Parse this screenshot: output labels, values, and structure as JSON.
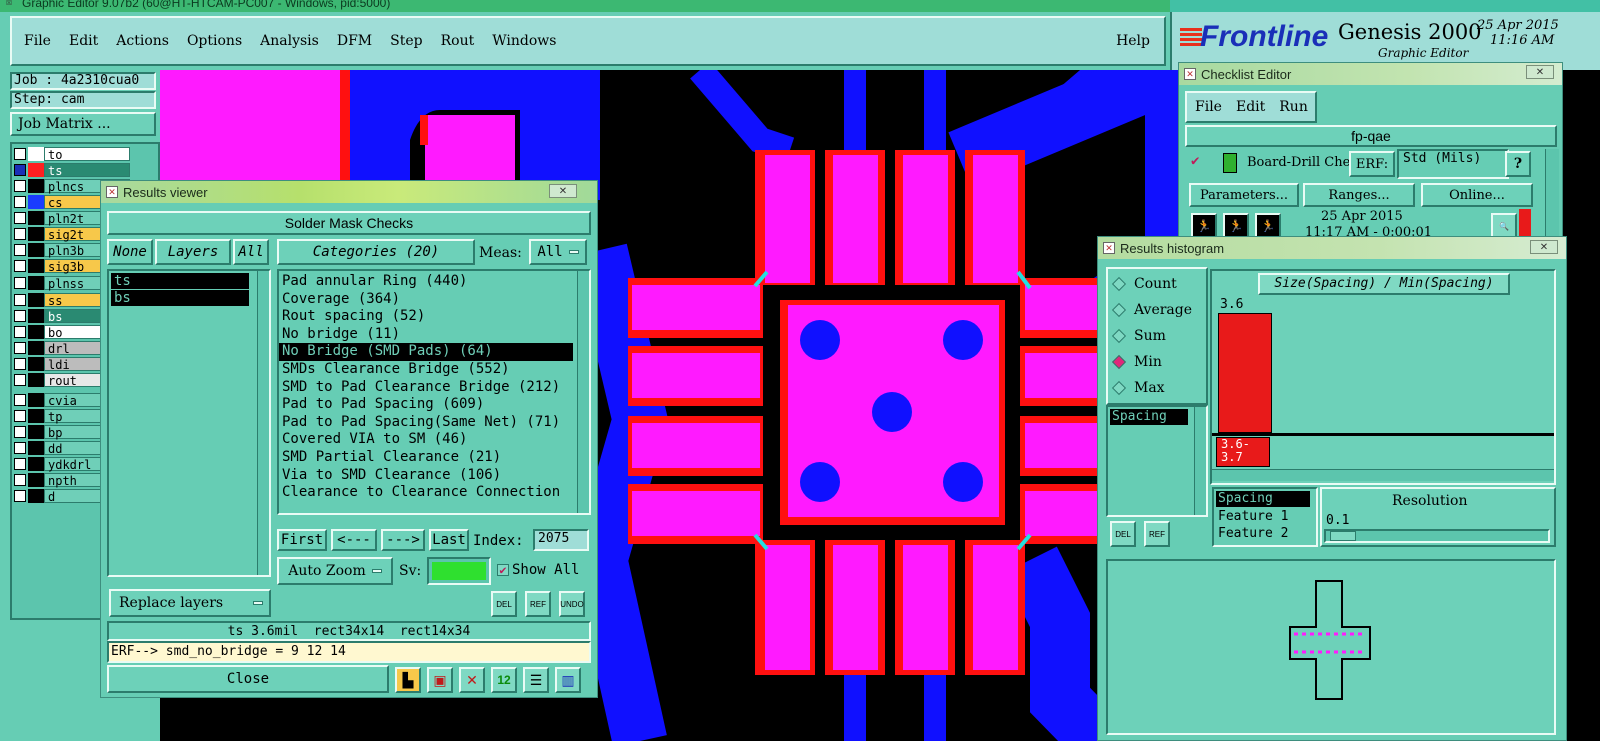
{
  "app": {
    "title": "Graphic Editor 9.07b2 (60@HT-HTCAM-PC007 - Windows, pid:5000)",
    "menu": [
      "File",
      "Edit",
      "Actions",
      "Options",
      "Analysis",
      "DFM",
      "Step",
      "Rout",
      "Windows"
    ],
    "help": "Help",
    "brand": "Frontline",
    "product": "Genesis 2000",
    "product_sub": "Graphic Editor",
    "date": "25 Apr 2015",
    "time": "11:16 AM"
  },
  "job": {
    "job_label": "Job : 4a2310cua0",
    "step_label": "Step: cam",
    "matrix_button": "Job Matrix ...",
    "layers": [
      {
        "name": "to",
        "color": "#ffffff",
        "bg": "#ffffff",
        "sel": false
      },
      {
        "name": "ts",
        "color": "#ff2020",
        "bg": "#2a8a72",
        "sel": true
      },
      {
        "name": "plncs",
        "color": "#000000",
        "bg": "#6fcfb8",
        "sel": false
      },
      {
        "name": "cs",
        "color": "#1a3cff",
        "bg": "#f7c84a",
        "sel": false
      },
      {
        "name": "pln2t",
        "color": "#000000",
        "bg": "#6fcfb8",
        "sel": false
      },
      {
        "name": "sig2t",
        "color": "#000000",
        "bg": "#f7c84a",
        "sel": false
      },
      {
        "name": "pln3b",
        "color": "#000000",
        "bg": "#6fcfb8",
        "sel": false
      },
      {
        "name": "sig3b",
        "color": "#000000",
        "bg": "#f7c84a",
        "sel": false
      },
      {
        "name": "plnss",
        "color": "#000000",
        "bg": "#6fcfb8",
        "sel": false
      },
      {
        "name": "ss",
        "color": "#000000",
        "bg": "#f7c84a",
        "sel": false
      },
      {
        "name": "bs",
        "color": "#000000",
        "bg": "#2a8a72",
        "sel": false
      },
      {
        "name": "bo",
        "color": "#000000",
        "bg": "#ffffff",
        "sel": false
      },
      {
        "name": "drl",
        "color": "#000000",
        "bg": "#bcbcbc",
        "sel": false
      },
      {
        "name": "ldi",
        "color": "#000000",
        "bg": "#bcbcbc",
        "sel": false
      },
      {
        "name": "rout",
        "color": "#000000",
        "bg": "#e8e8e8",
        "sel": false
      },
      {
        "name": "cvia",
        "color": "#000000",
        "bg": "#6fcfb8",
        "sel": false
      },
      {
        "name": "tp",
        "color": "#000000",
        "bg": "#6fcfb8",
        "sel": false
      },
      {
        "name": "bp",
        "color": "#000000",
        "bg": "#6fcfb8",
        "sel": false
      },
      {
        "name": "dd",
        "color": "#000000",
        "bg": "#6fcfb8",
        "sel": false
      },
      {
        "name": "ydkdrl",
        "color": "#000000",
        "bg": "#6fcfb8",
        "sel": false
      },
      {
        "name": "npth",
        "color": "#000000",
        "bg": "#6fcfb8",
        "sel": false
      },
      {
        "name": "d",
        "color": "#000000",
        "bg": "#6fcfb8",
        "sel": false
      }
    ]
  },
  "results_viewer": {
    "title": "Results viewer",
    "header": "Solder Mask Checks",
    "none_btn": "None",
    "layers_btn": "Layers",
    "all_btn": "All",
    "layers": [
      "ts",
      "bs"
    ],
    "categories_btn": "Categories (20)",
    "meas_label": "Meas:",
    "meas_value": "All",
    "categories": [
      "Pad annular Ring (440)",
      "Coverage (364)",
      "Rout spacing (52)",
      "No bridge (11)",
      "No Bridge (SMD Pads) (64)",
      "SMDs Clearance Bridge (552)",
      "SMD to Pad Clearance Bridge (212)",
      "Pad to Pad Spacing (609)",
      "Pad to Pad Spacing(Same Net) (71)",
      "Covered VIA to SM (46)",
      "SMD Partial Clearance (21)",
      "Via to SMD Clearance (106)",
      "Clearance to Clearance Connection"
    ],
    "selected_index": 4,
    "first": "First",
    "prev": "<---",
    "next": "--->",
    "last": "Last",
    "index_label": "Index:",
    "index_value": "2075",
    "auto_zoom": "Auto Zoom",
    "sv_label": "Sv:",
    "show_all": "Show All",
    "replace_layers": "Replace layers",
    "status": "ts 3.6mil  rect34x14  rect14x34",
    "erf_line": "ERF--> smd_no_bridge = 9 12 14",
    "close": "Close",
    "del": "DEL",
    "ref": "REF",
    "undo": "UNDO"
  },
  "checklist": {
    "title": "Checklist Editor",
    "menu": [
      "File",
      "Edit",
      "Run"
    ],
    "name": "fp-qae",
    "item": "Board-Drill Che",
    "erf": "ERF:",
    "std": "Std (Mils)",
    "help": "?",
    "parameters": "Parameters...",
    "ranges": "Ranges...",
    "online": "Online...",
    "date": "25 Apr 2015",
    "time": "11:17 AM - 0:00:01"
  },
  "histogram": {
    "title": "Results histogram",
    "options": [
      "Count",
      "Average",
      "Sum",
      "Min",
      "Max"
    ],
    "selected": "Min",
    "chart_title": "Size(Spacing) / Min(Spacing)",
    "measure_list": [
      "Spacing"
    ],
    "bar_value": "3.6",
    "bar_label": "3.6-\n3.7",
    "fields": [
      "Spacing",
      "Feature 1",
      "Feature 2"
    ],
    "resolution_label": "Resolution",
    "resolution_value": "0.1",
    "del": "DEL",
    "ref": "REF"
  }
}
